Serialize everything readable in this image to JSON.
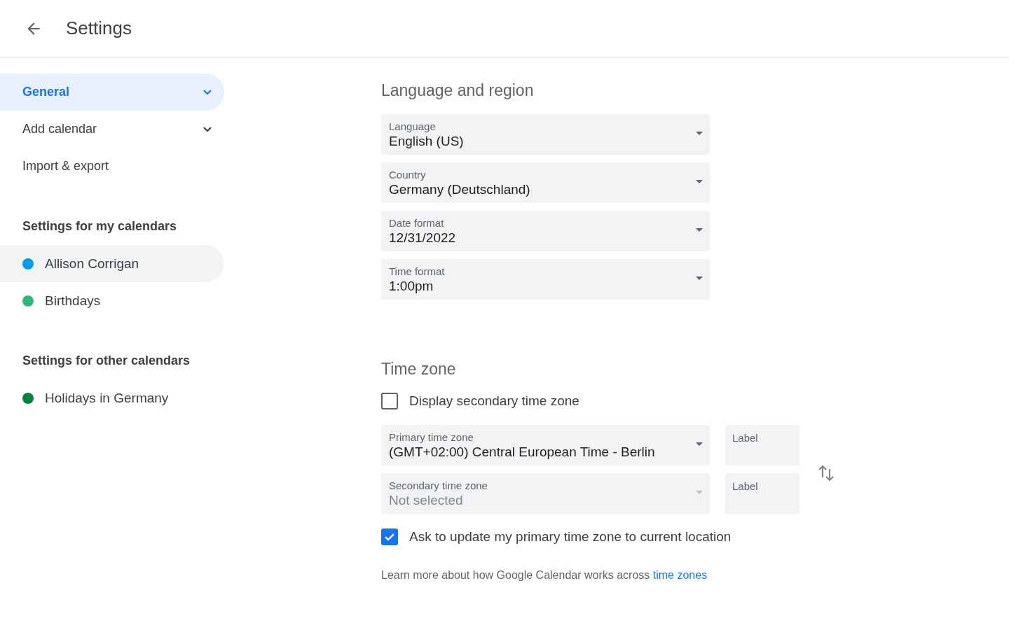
{
  "header": {
    "title": "Settings"
  },
  "sidebar": {
    "items": [
      {
        "label": "General",
        "selected": true,
        "expandable": true
      },
      {
        "label": "Add calendar",
        "selected": false,
        "expandable": true
      },
      {
        "label": "Import & export",
        "selected": false,
        "expandable": false
      }
    ],
    "sections": [
      {
        "heading": "Settings for my calendars",
        "calendars": [
          {
            "name": "Allison Corrigan",
            "color": "#039be5",
            "hovered": true
          },
          {
            "name": "Birthdays",
            "color": "#33b679",
            "hovered": false
          }
        ]
      },
      {
        "heading": "Settings for other calendars",
        "calendars": [
          {
            "name": "Holidays in Germany",
            "color": "#0b8043",
            "hovered": false
          }
        ]
      }
    ]
  },
  "language_region": {
    "heading": "Language and region",
    "fields": [
      {
        "label": "Language",
        "value": "English (US)"
      },
      {
        "label": "Country",
        "value": "Germany (Deutschland)"
      },
      {
        "label": "Date format",
        "value": "12/31/2022"
      },
      {
        "label": "Time format",
        "value": "1:00pm"
      }
    ]
  },
  "time_zone": {
    "heading": "Time zone",
    "secondary_checkbox": {
      "label": "Display secondary time zone",
      "checked": false
    },
    "zones": [
      {
        "label": "Primary time zone",
        "value": "(GMT+02:00) Central European Time - Berlin",
        "disabled": false,
        "label_placeholder": "Label"
      },
      {
        "label": "Secondary time zone",
        "value": "Not selected",
        "disabled": true,
        "label_placeholder": "Label"
      }
    ],
    "update_checkbox": {
      "label": "Ask to update my primary time zone to current location",
      "checked": true
    },
    "footnote": {
      "text": "Learn more about how Google Calendar works across",
      "link": "time zones"
    }
  }
}
